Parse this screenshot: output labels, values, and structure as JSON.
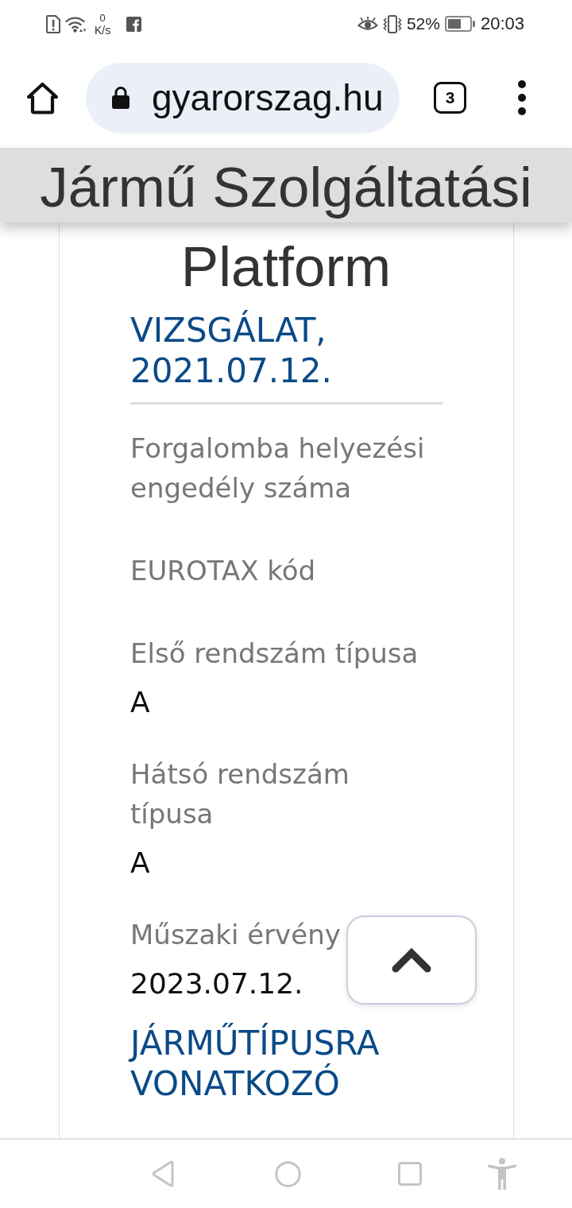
{
  "status_bar": {
    "net_speed": "0",
    "net_speed_unit": "K/s",
    "battery": "52%",
    "time": "20:03"
  },
  "browser": {
    "url": "gyarorszag.hu",
    "tab_count": "3"
  },
  "header": {
    "title": "Jármű Szolgáltatási Platform"
  },
  "content": {
    "heading": "VIZSGÁLAT, 2021.07.12.",
    "fields": [
      {
        "label": "Forgalomba helyezési engedély száma"
      },
      {
        "label": "EUROTAX kód"
      },
      {
        "label": "Első rendszám típusa",
        "value": "A"
      },
      {
        "label": "Hátsó rendszám típusa",
        "value": "A"
      },
      {
        "label": "Műszaki érvény",
        "value": "2023.07.12."
      }
    ],
    "next_heading": "JÁRMŰTÍPUSRA VONATKOZÓ"
  }
}
